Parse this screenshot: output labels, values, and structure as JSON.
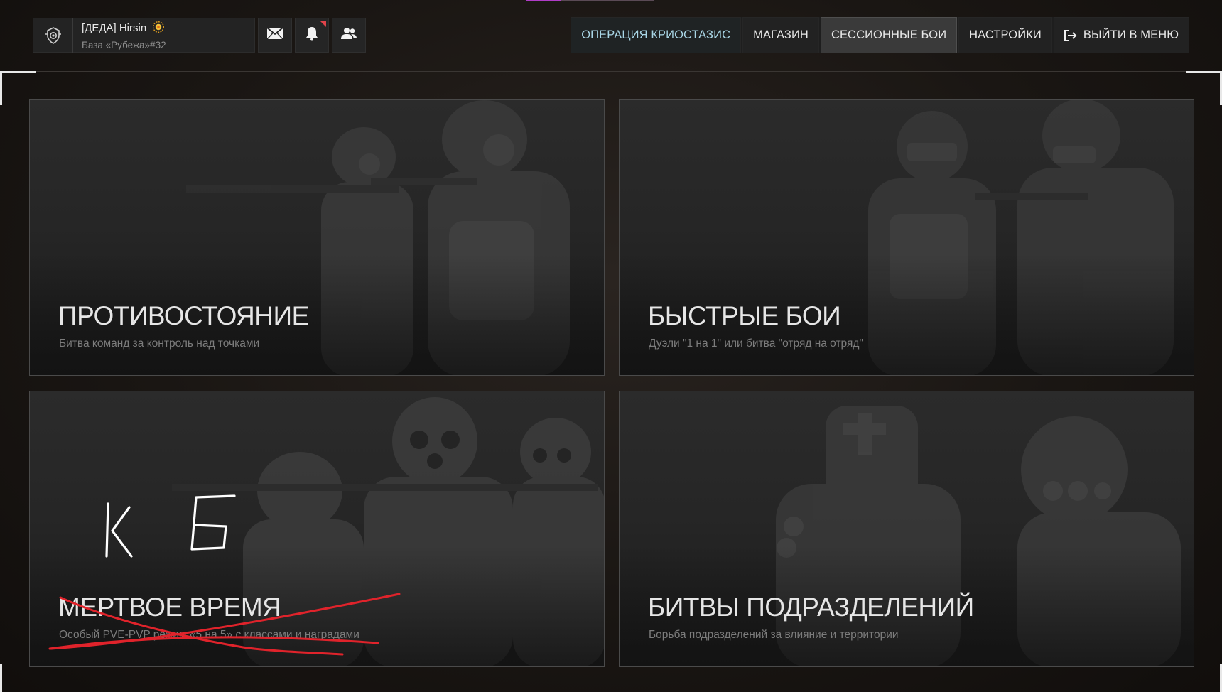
{
  "player": {
    "name": "[ДЕДА] Hirsin",
    "base": "База «Рубежа»#32"
  },
  "nav": {
    "items": [
      {
        "label": "ОПЕРАЦИЯ КРИОСТАЗИС"
      },
      {
        "label": "МАГАЗИН"
      },
      {
        "label": "СЕССИОННЫЕ БОИ"
      },
      {
        "label": "НАСТРОЙКИ"
      },
      {
        "label": "ВЫЙТИ В МЕНЮ"
      }
    ],
    "active_item": "СЕССИОННЫЕ БОИ",
    "highlight_color": "#a9d6e6"
  },
  "modes": [
    {
      "title": "ПРОТИВОСТОЯНИЕ",
      "description": "Битва команд за контроль над точками"
    },
    {
      "title": "БЫСТРЫЕ БОИ",
      "description": "Дуэли \"1 на 1\" или битва \"отряд на отряд\""
    },
    {
      "title": "МЕРТВОЕ ВРЕМЯ",
      "description": "Особый PVE-PVP режим «5 на 5» с классами и наградами"
    },
    {
      "title": "БИТВЫ ПОДРАЗДЕЛЕНИЙ",
      "description": "Борьба подразделений за влияние и территории"
    }
  ],
  "annotation": {
    "handwritten_text": "К Б",
    "color": "#e0232b",
    "strikethrough_card": "МЕРТВОЕ ВРЕМЯ"
  },
  "icons": {
    "emblem": "clan-emblem-icon",
    "badge": "rank-badge-icon",
    "mail": "mail-icon",
    "bell": "bell-icon",
    "friends": "friends-icon",
    "exit": "exit-icon"
  },
  "colors": {
    "notification": "#e0434a",
    "top_accent": "#b03cc8"
  }
}
